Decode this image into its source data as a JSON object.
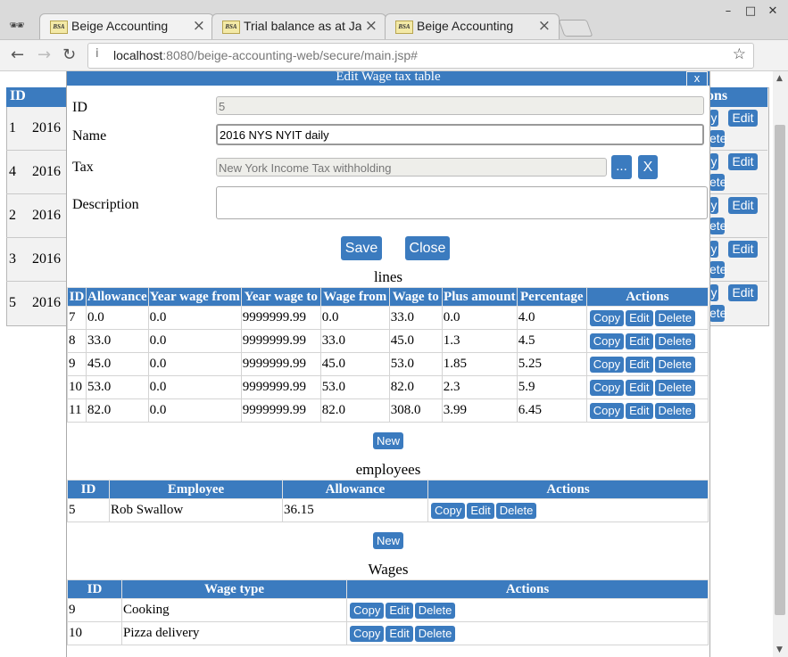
{
  "browser": {
    "tabs": [
      {
        "title": "Beige Accounting",
        "favicon": "BSA"
      },
      {
        "title": "Trial balance as at Jan",
        "favicon": "BSA"
      },
      {
        "title": "Beige Accounting",
        "favicon": "BSA"
      }
    ],
    "url_host": "localhost",
    "url_rest": ":8080/beige-accounting-web/secure/main.jsp#",
    "info_icon": "i"
  },
  "background_list": {
    "header_id": "ID",
    "header_actions": "ons",
    "rows": [
      {
        "id": "1",
        "name": "2016"
      },
      {
        "id": "4",
        "name": "2016"
      },
      {
        "id": "2",
        "name": "2016"
      },
      {
        "id": "3",
        "name": "2016"
      },
      {
        "id": "5",
        "name": "2016"
      }
    ],
    "copy_fragment": "y",
    "edit_label": "Edit",
    "delete_fragment": "ete"
  },
  "dialog": {
    "title": "Edit Wage tax table",
    "close_label": "x",
    "fields": {
      "id_label": "ID",
      "id_value": "5",
      "name_label": "Name",
      "name_value": "2016 NYS NYIT daily",
      "tax_label": "Tax",
      "tax_value": "New York Income Tax withholding",
      "tax_pick_label": "...",
      "tax_clear_label": "X",
      "description_label": "Description",
      "description_value": ""
    },
    "save_label": "Save",
    "close_button_label": "Close",
    "lines": {
      "title": "lines",
      "headers": [
        "ID",
        "Allowance",
        "Year wage from",
        "Year wage to",
        "Wage from",
        "Wage to",
        "Plus amount",
        "Percentage",
        "Actions"
      ],
      "rows": [
        [
          "7",
          "0.0",
          "0.0",
          "9999999.99",
          "0.0",
          "33.0",
          "0.0",
          "4.0"
        ],
        [
          "8",
          "33.0",
          "0.0",
          "9999999.99",
          "33.0",
          "45.0",
          "1.3",
          "4.5"
        ],
        [
          "9",
          "45.0",
          "0.0",
          "9999999.99",
          "45.0",
          "53.0",
          "1.85",
          "5.25"
        ],
        [
          "10",
          "53.0",
          "0.0",
          "9999999.99",
          "53.0",
          "82.0",
          "2.3",
          "5.9"
        ],
        [
          "11",
          "82.0",
          "0.0",
          "9999999.99",
          "82.0",
          "308.0",
          "3.99",
          "6.45"
        ]
      ],
      "new_label": "New"
    },
    "employees": {
      "title": "employees",
      "headers": [
        "ID",
        "Employee",
        "Allowance",
        "Actions"
      ],
      "rows": [
        [
          "5",
          "Rob Swallow",
          "36.15"
        ]
      ],
      "new_label": "New"
    },
    "wages": {
      "title": "Wages",
      "headers": [
        "ID",
        "Wage type",
        "Actions"
      ],
      "rows": [
        [
          "9",
          "Cooking"
        ],
        [
          "10",
          "Pizza delivery"
        ]
      ]
    },
    "actions": {
      "copy": "Copy",
      "edit": "Edit",
      "delete": "Delete"
    }
  }
}
